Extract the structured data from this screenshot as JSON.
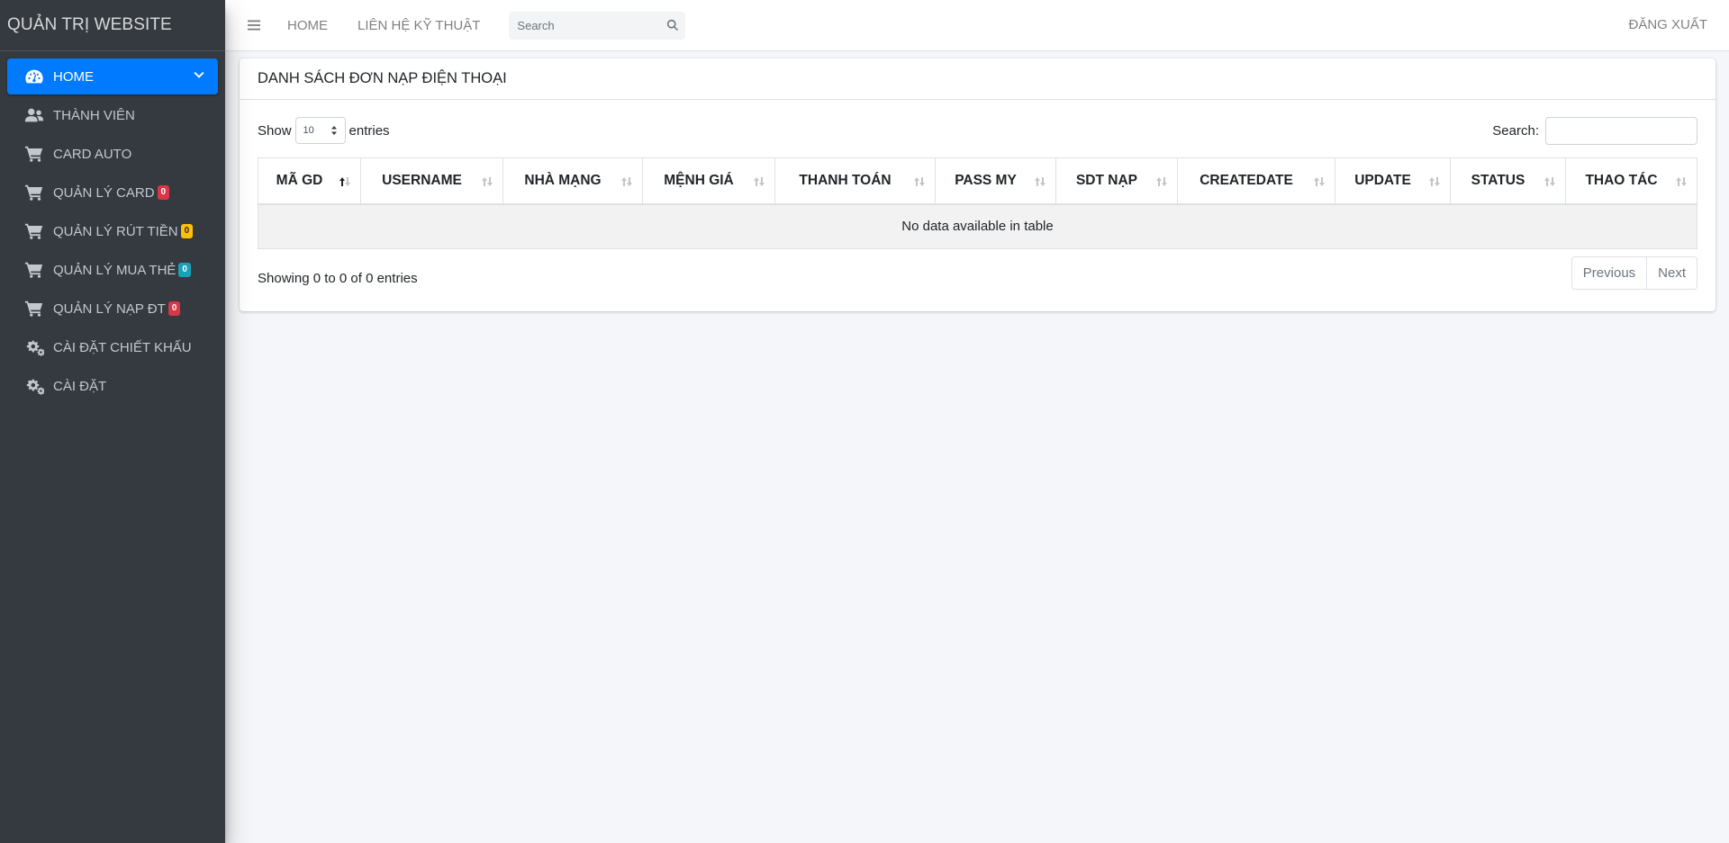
{
  "brand": {
    "title": "QUẢN TRỊ WEBSITE"
  },
  "sidebar": {
    "items": [
      {
        "label": "HOME",
        "icon": "dashboard-icon",
        "active": true
      },
      {
        "label": "THÀNH VIÊN",
        "icon": "users-icon"
      },
      {
        "label": "CARD AUTO",
        "icon": "cart-icon"
      },
      {
        "label": "QUẢN LÝ CARD",
        "icon": "cart-icon",
        "badge": "0",
        "badge_color": "#dc3545"
      },
      {
        "label": "QUẢN LÝ RÚT TIỀN",
        "icon": "cart-icon",
        "badge": "0",
        "badge_color": "#ffc107"
      },
      {
        "label": "QUẢN LÝ MUA THẺ",
        "icon": "cart-icon",
        "badge": "0",
        "badge_color": "#17a2b8"
      },
      {
        "label": "QUẢN LÝ NẠP ĐT",
        "icon": "cart-icon",
        "badge": "0",
        "badge_color": "#dc3545"
      },
      {
        "label": "CÀI ĐẶT CHIẾT KHẤU",
        "icon": "cogs-icon"
      },
      {
        "label": "CÀI ĐẶT",
        "icon": "cogs-icon"
      }
    ]
  },
  "topbar": {
    "links": [
      "HOME",
      "LIÊN HỆ KỸ THUẬT"
    ],
    "search_placeholder": "Search",
    "logout": "ĐĂNG XUẤT"
  },
  "card": {
    "title": "DANH SÁCH ĐƠN NẠP ĐIỆN THOẠI",
    "length": {
      "prefix": "Show",
      "value": "10",
      "suffix": "entries"
    },
    "filter_label": "Search:",
    "columns": [
      "MÃ GD",
      "USERNAME",
      "NHÀ MẠNG",
      "MỆNH GIÁ",
      "THANH TOÁN",
      "PASS MY",
      "SDT NẠP",
      "CREATEDATE",
      "UPDATE",
      "STATUS",
      "THAO TÁC"
    ],
    "empty_message": "No data available in table",
    "info": "Showing 0 to 0 of 0 entries",
    "pagination": {
      "previous": "Previous",
      "next": "Next"
    }
  },
  "colors": {
    "sidebar_bg": "#343a40",
    "accent": "#007bff"
  }
}
